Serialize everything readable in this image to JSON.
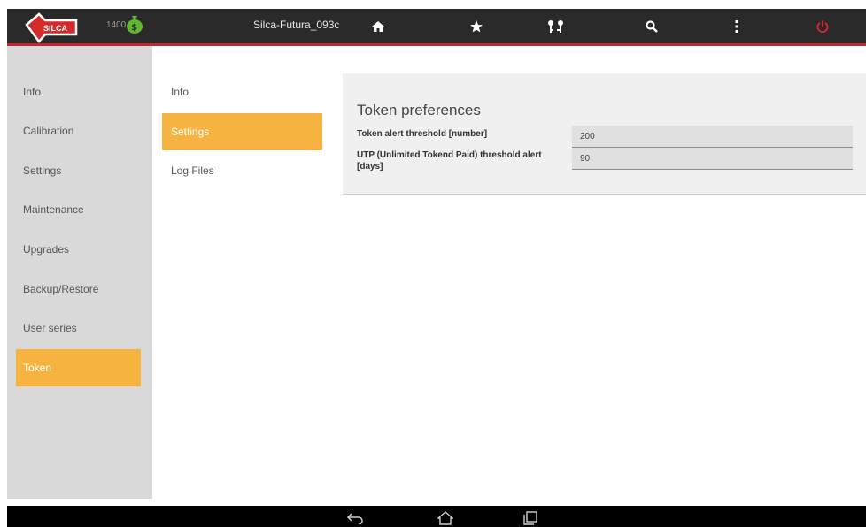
{
  "topbar": {
    "logo_text": "SILCA",
    "token_count": "1400",
    "device_name": "Silca-Futura_093c",
    "icons": [
      "logo",
      "money-bag-icon",
      "home-icon",
      "star-icon",
      "keys-icon",
      "search-icon",
      "more-vert-icon",
      "power-icon"
    ],
    "colors": {
      "bar": "#2a2a2a",
      "accent_line": "#c1272d",
      "power": "#e52528",
      "money": "#5fb930"
    }
  },
  "sidebar": {
    "items": [
      {
        "label": "Info"
      },
      {
        "label": "Calibration"
      },
      {
        "label": "Settings"
      },
      {
        "label": "Maintenance"
      },
      {
        "label": "Upgrades"
      },
      {
        "label": "Backup/Restore"
      },
      {
        "label": "User series"
      },
      {
        "label": "Token"
      }
    ],
    "active": "Token"
  },
  "submenu": {
    "items": [
      {
        "label": "Info"
      },
      {
        "label": "Settings"
      },
      {
        "label": "Log Files"
      }
    ],
    "active": "Settings"
  },
  "panel": {
    "title": "Token preferences",
    "rows": [
      {
        "label": "Token alert threshold [number]",
        "value": "200"
      },
      {
        "label": "UTP (Unlimited Tokend Paid) threshold alert [days]",
        "value": "90"
      }
    ]
  },
  "navbar": {
    "icons": [
      "back-icon",
      "home-outline-icon",
      "recent-apps-icon"
    ]
  },
  "colors": {
    "active_orange": "#f6b33f",
    "sidebar_bg": "#d9d9d9",
    "panel_bg": "#f0f0f0"
  }
}
